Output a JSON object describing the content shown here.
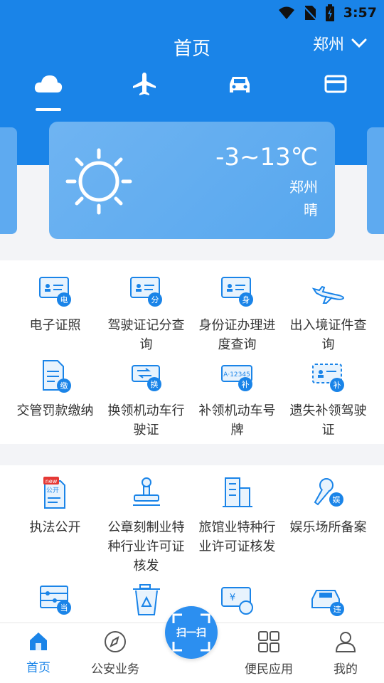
{
  "status": {
    "time": "3:57"
  },
  "header": {
    "title": "首页",
    "city": "郑州"
  },
  "top_tabs": [
    "weather-icon",
    "airplane-icon",
    "car-icon",
    "card-icon"
  ],
  "weather": {
    "temp": "-3~13℃",
    "city": "郑州",
    "condition": "晴"
  },
  "services1": [
    {
      "label": "电子证照",
      "badge": "电"
    },
    {
      "label": "驾驶证记分查询",
      "badge": "分"
    },
    {
      "label": "身份证办理进度查询",
      "badge": "身"
    },
    {
      "label": "出入境证件查询",
      "badge": ""
    },
    {
      "label": "交管罚款缴纳",
      "badge": "缴"
    },
    {
      "label": "换领机动车行驶证",
      "badge": "换"
    },
    {
      "label": "补领机动车号牌",
      "badge": "补",
      "plate": "A·12345"
    },
    {
      "label": "遗失补领驾驶证",
      "badge": "补"
    }
  ],
  "services2": [
    {
      "label": "执法公开",
      "badge_new": "new",
      "doc": "公开"
    },
    {
      "label": "公章刻制业特种行业许可证核发"
    },
    {
      "label": "旅馆业特种行业许可证核发"
    },
    {
      "label": "娱乐场所备案",
      "badge": "娱"
    },
    {
      "label": "",
      "badge": "当"
    },
    {
      "label": ""
    },
    {
      "label": "",
      "badge": "¥"
    },
    {
      "label": "",
      "badge": "违"
    }
  ],
  "scan": {
    "label": "扫一扫"
  },
  "nav": [
    {
      "label": "首页"
    },
    {
      "label": "公安业务"
    },
    {
      "label": "便民应用"
    },
    {
      "label": "我的"
    }
  ]
}
